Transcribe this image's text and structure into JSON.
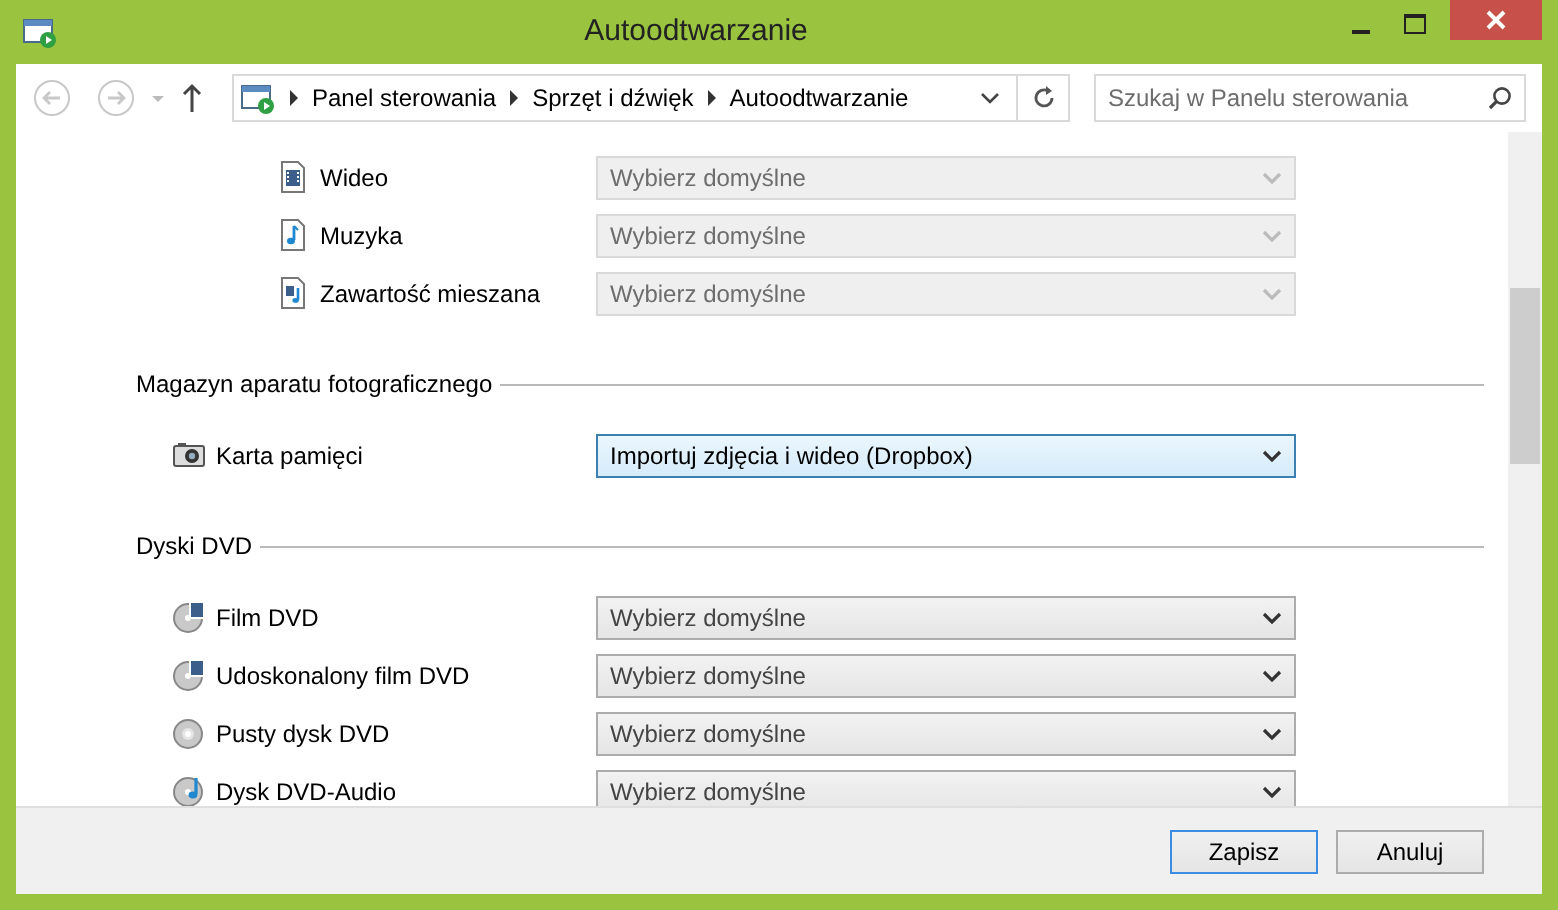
{
  "window": {
    "title": "Autoodtwarzanie"
  },
  "address_bar": {
    "crumbs": [
      "Panel sterowania",
      "Sprzęt i dźwięk",
      "Autoodtwarzanie"
    ]
  },
  "search": {
    "placeholder": "Szukaj w Panelu sterowania"
  },
  "sections": [
    {
      "items": [
        {
          "kind": "video",
          "label": "Wideo",
          "value": "Wybierz domyślne",
          "disabled": true,
          "focused": false
        },
        {
          "kind": "music",
          "label": "Muzyka",
          "value": "Wybierz domyślne",
          "disabled": true,
          "focused": false
        },
        {
          "kind": "mixed",
          "label": "Zawartość mieszana",
          "value": "Wybierz domyślne",
          "disabled": true,
          "focused": false
        }
      ]
    },
    {
      "heading": "Magazyn aparatu fotograficznego",
      "items": [
        {
          "kind": "camera",
          "label": "Karta pamięci",
          "value": "Importuj zdjęcia i wideo (Dropbox)",
          "disabled": false,
          "focused": true
        }
      ]
    },
    {
      "heading": "Dyski DVD",
      "items": [
        {
          "kind": "dvd-video",
          "label": "Film DVD",
          "value": "Wybierz domyślne",
          "disabled": false,
          "focused": false
        },
        {
          "kind": "dvd-video",
          "label": "Udoskonalony film DVD",
          "value": "Wybierz domyślne",
          "disabled": false,
          "focused": false
        },
        {
          "kind": "dvd-blank",
          "label": "Pusty dysk DVD",
          "value": "Wybierz domyślne",
          "disabled": false,
          "focused": false
        },
        {
          "kind": "dvd-audio",
          "label": "Dysk DVD-Audio",
          "value": "Wybierz domyślne",
          "disabled": false,
          "focused": false
        }
      ]
    }
  ],
  "buttons": [
    {
      "label": "Zapisz",
      "default": true
    },
    {
      "label": "Anuluj",
      "default": false
    }
  ]
}
